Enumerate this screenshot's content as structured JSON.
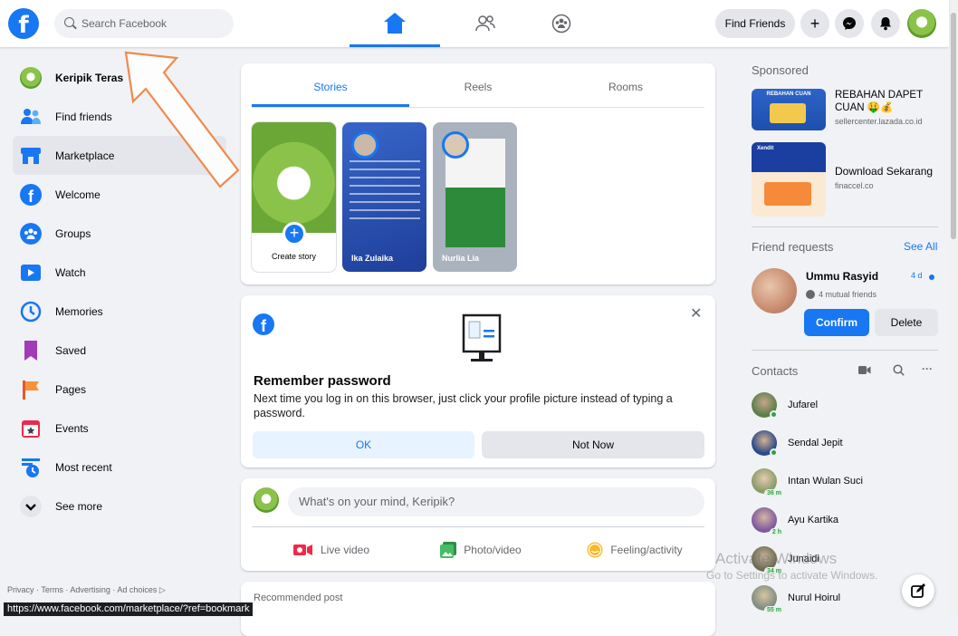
{
  "topbar": {
    "logo_letter": "f",
    "search_placeholder": "Search Facebook",
    "find_friends_label": "Find Friends",
    "plus_label": "+"
  },
  "left_nav": {
    "items": [
      {
        "label": "Keripik Teras",
        "icon": "profile-avatar"
      },
      {
        "label": "Find friends",
        "icon": "friends-icon"
      },
      {
        "label": "Marketplace",
        "icon": "marketplace-icon"
      },
      {
        "label": "Welcome",
        "icon": "facebook-icon"
      },
      {
        "label": "Groups",
        "icon": "groups-icon"
      },
      {
        "label": "Watch",
        "icon": "watch-icon"
      },
      {
        "label": "Memories",
        "icon": "memories-icon"
      },
      {
        "label": "Saved",
        "icon": "saved-icon"
      },
      {
        "label": "Pages",
        "icon": "pages-icon"
      },
      {
        "label": "Events",
        "icon": "events-icon"
      },
      {
        "label": "Most recent",
        "icon": "most-recent-icon"
      },
      {
        "label": "See more",
        "icon": "chevron-down-icon"
      }
    ],
    "footer": "Privacy · Terms · Advertising · Ad choices ▷",
    "status_url": "https://www.facebook.com/marketplace/?ref=bookmark"
  },
  "stories": {
    "tabs": [
      "Stories",
      "Reels",
      "Rooms"
    ],
    "create_label": "Create story",
    "create_plus": "+",
    "cards": [
      {
        "name": "Ika Zulaika"
      },
      {
        "name": "Nurlia Lia"
      }
    ]
  },
  "remember_password": {
    "title": "Remember password",
    "body": "Next time you log in on this browser, just click your profile picture instead of typing a password.",
    "ok_label": "OK",
    "not_now_label": "Not Now",
    "close_glyph": "✕",
    "logo_letter": "f"
  },
  "composer": {
    "placeholder": "What's on your mind, Keripik?",
    "actions": [
      {
        "label": "Live video",
        "color": "#f02849"
      },
      {
        "label": "Photo/video",
        "color": "#45bd62"
      },
      {
        "label": "Feeling/activity",
        "color": "#f7b928"
      }
    ]
  },
  "recommended": {
    "label": "Recommended post"
  },
  "sponsored": {
    "heading": "Sponsored",
    "ads": [
      {
        "title": "REBAHAN DAPET CUAN 🤑💰",
        "domain": "sellercenter.lazada.co.id",
        "thumb_text": "REBAHAN CUAN"
      },
      {
        "title": "Download Sekarang",
        "domain": "finaccel.co",
        "thumb_text": "Xendit"
      }
    ]
  },
  "friend_requests": {
    "heading": "Friend requests",
    "see_all": "See All",
    "name": "Ummu Rasyid",
    "time": "4 d",
    "mutual": "4 mutual friends",
    "confirm_label": "Confirm",
    "delete_label": "Delete"
  },
  "contacts": {
    "heading": "Contacts",
    "more_glyph": "···",
    "items": [
      {
        "name": "Jufarel",
        "status": "online"
      },
      {
        "name": "Sendal Jepit",
        "status": "online"
      },
      {
        "name": "Intan Wulan Suci",
        "status": "36 m"
      },
      {
        "name": "Ayu Kartika",
        "status": "2 h"
      },
      {
        "name": "Junaidi",
        "status": "34 m"
      },
      {
        "name": "Nurul Hoirul",
        "status": "55 m"
      }
    ]
  },
  "watermark": {
    "line1": "Activate Windows",
    "line2": "Go to Settings to activate Windows."
  },
  "colors": {
    "brand": "#1877f2",
    "annotation_arrow": "#f08a4b"
  }
}
